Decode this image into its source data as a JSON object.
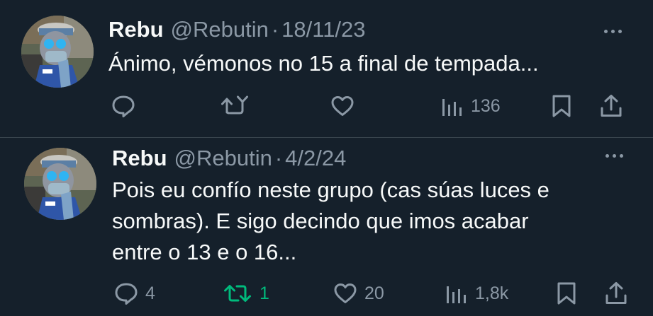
{
  "tweets": [
    {
      "name": "Rebu",
      "handle": "@Rebutin",
      "separator": "·",
      "date": "18/11/23",
      "text": "Ánimo, vémonos no 15 a final de tempada...",
      "actions": {
        "reply_count": "",
        "retweet_count": "",
        "like_count": "",
        "view_count": "136"
      }
    },
    {
      "name": "Rebu",
      "handle": "@Rebutin",
      "separator": "·",
      "date": "4/2/24",
      "text": "Pois eu confío neste grupo (cas súas luces e\nsombras). E sigo decindo que imos acabar\nentre o 13 e o 16...",
      "actions": {
        "reply_count": "4",
        "retweet_count": "1",
        "like_count": "20",
        "view_count": "1,8k"
      }
    }
  ],
  "colors": {
    "background": "#15202b",
    "text_primary": "#f7f9f9",
    "text_secondary": "#8b98a5",
    "divider": "#38444d",
    "retweet_active": "#00ba7c"
  },
  "icons": [
    "reply-icon",
    "retweet-icon",
    "like-icon",
    "views-icon",
    "bookmark-icon",
    "share-icon",
    "more-icon"
  ]
}
